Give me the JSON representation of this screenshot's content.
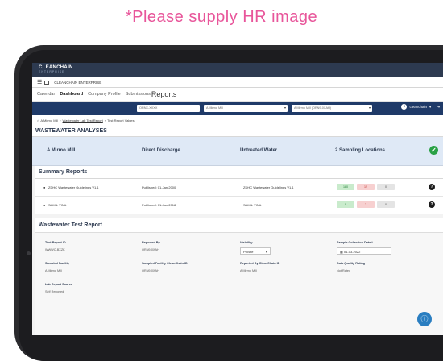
{
  "note": "*Please supply HR image",
  "topbar": {
    "logo": "CLEANCHAIN",
    "logo_sub": "ENTERPRISE"
  },
  "appbar": {
    "title": "CLEANCHAIN ENTERPRISE"
  },
  "tabs": {
    "calendar": "Calendar",
    "dashboard": "Dashboard",
    "company_profile": "Company Profile",
    "submissions": "Submissions",
    "reports": "Reports"
  },
  "filterbar": {
    "field1": "ORNX-XXXX",
    "field2": "A Mirmo Mill",
    "field3": "A Mirmo Mill (ORN9-0XAH)",
    "user": "cleanchain"
  },
  "breadcrumb": {
    "home": "A Mirmo Mill",
    "link": "Wastewater Lab Test Report",
    "current": "Test Report Values"
  },
  "page_title": "WASTEWATER ANALYSES",
  "summary_bar": {
    "facility": "A Mirmo Mill",
    "discharge": "Direct Discharge",
    "water": "Untreated Water",
    "locations": "2 Sampling Locations"
  },
  "summary_reports": {
    "title": "Summary Reports",
    "rows": [
      {
        "name": "ZDHC Wastewater Guidelines V1.1",
        "published": "Published: 01-Jan-2000",
        "guideline": "ZDHC Wastewater Guidelines V1.1",
        "pass": "180",
        "fail": "12",
        "other": "0"
      },
      {
        "name": "SAMIL VINA",
        "published": "Published: 01-Jan-2018",
        "guideline": "SAMIL VINA",
        "pass": "0",
        "fail": "2",
        "other": "0"
      }
    ]
  },
  "test_report": {
    "title": "Wastewater Test Report",
    "report_id_label": "Test Report ID",
    "report_id": "WWWC-BXZK",
    "reported_by_label": "Reported By",
    "reported_by": "ORN9-0XAH",
    "visibility_label": "Visibility",
    "visibility": "Private",
    "date_label": "Sample Collection Date *",
    "date": "01-03-2022",
    "facility_label": "Sampled Facility",
    "facility": "A Mirmo Mill",
    "facility_id_label": "Sampled Facility CleanChain ID",
    "facility_id": "ORN9-0XAH",
    "reported_cc_label": "Reported By CleanChain ID",
    "reported_cc": "A Mirmo Mill",
    "quality_label": "Data Quality Rating",
    "quality": "Not Rated",
    "source_label": "Lab Report Source",
    "source": "Self Reported"
  },
  "colors": {
    "navy": "#1f3a68",
    "accent": "#2a7ec1",
    "note": "#e8559a",
    "ok": "#29a145"
  }
}
